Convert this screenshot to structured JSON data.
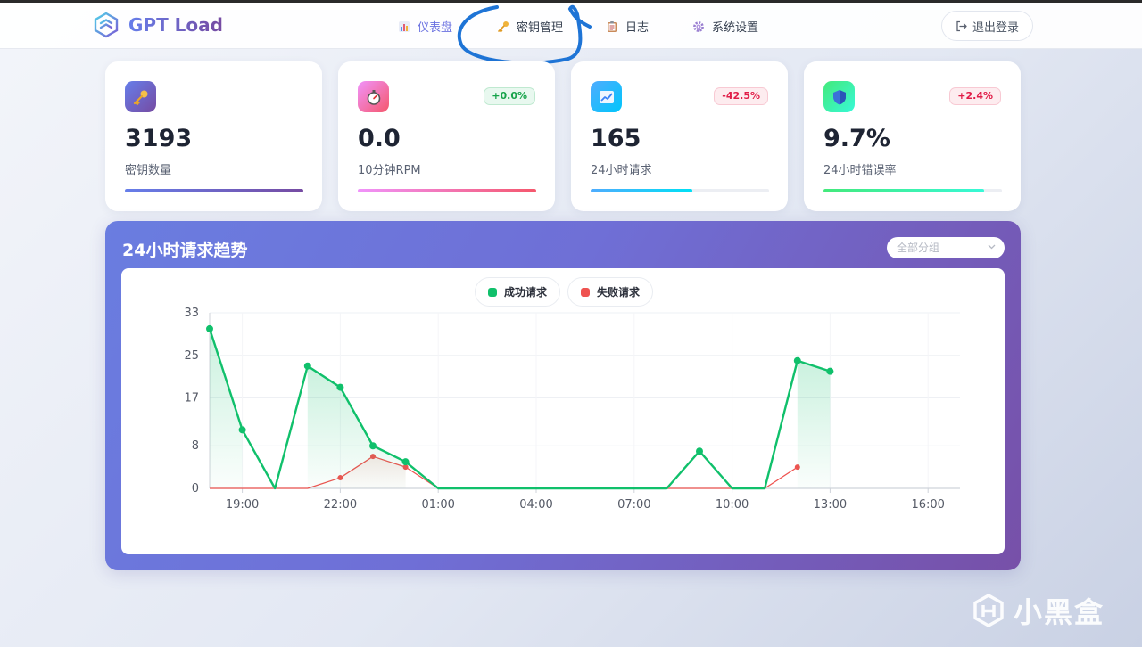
{
  "app": {
    "name": "GPT Load"
  },
  "nav": {
    "items": [
      {
        "label": "仪表盘",
        "icon": "bar-chart-icon",
        "active": true
      },
      {
        "label": "密钥管理",
        "icon": "key-icon",
        "active": false
      },
      {
        "label": "日志",
        "icon": "clipboard-icon",
        "active": false
      },
      {
        "label": "系统设置",
        "icon": "gear-icon",
        "active": false
      }
    ],
    "logout_label": "退出登录"
  },
  "stats": [
    {
      "value": "3193",
      "label": "密钥数量",
      "badge": "",
      "icon": "key-icon",
      "progress": 1.0,
      "color": "#764ba2"
    },
    {
      "value": "0.0",
      "label": "10分钟RPM",
      "badge": "+0.0%",
      "icon": "stopwatch-icon",
      "progress": 1.0,
      "color": "#f5576c"
    },
    {
      "value": "165",
      "label": "24小时请求",
      "badge": "-42.5%",
      "icon": "trend-chart-icon",
      "progress": 0.57,
      "color": "#00c6fb"
    },
    {
      "value": "9.7%",
      "label": "24小时错误率",
      "badge": "+2.4%",
      "icon": "shield-icon",
      "progress": 0.9,
      "color": "#38f9d7"
    }
  ],
  "trend": {
    "title": "24小时请求趋势",
    "group_filter": {
      "placeholder": "全部分组"
    }
  },
  "chart_data": {
    "type": "line",
    "x": [
      "18:00",
      "19:00",
      "20:00",
      "21:00",
      "22:00",
      "23:00",
      "00:00",
      "01:00",
      "02:00",
      "03:00",
      "04:00",
      "05:00",
      "06:00",
      "07:00",
      "08:00",
      "09:00",
      "10:00",
      "11:00",
      "12:00",
      "13:00",
      "14:00",
      "15:00",
      "16:00",
      "17:00"
    ],
    "xtick_labels": [
      "19:00",
      "22:00",
      "01:00",
      "04:00",
      "07:00",
      "10:00",
      "13:00",
      "16:00"
    ],
    "yticks": [
      0,
      8,
      17,
      25,
      33
    ],
    "ylim": [
      0,
      33
    ],
    "series": [
      {
        "name": "成功请求",
        "color": "#10c06b",
        "values": [
          30,
          11,
          0,
          23,
          19,
          8,
          5,
          0,
          0,
          0,
          0,
          0,
          0,
          0,
          0,
          7,
          0,
          0,
          24,
          22,
          null,
          null,
          null,
          null
        ]
      },
      {
        "name": "失败请求",
        "color": "#ef5350",
        "values": [
          0,
          0,
          0,
          0,
          2,
          6,
          4,
          0,
          0,
          0,
          0,
          0,
          0,
          0,
          0,
          0,
          0,
          0,
          4,
          null,
          null,
          null,
          null,
          null
        ]
      }
    ],
    "legend_position": "top-center",
    "grid": true
  },
  "watermark": {
    "text": "小黑盒"
  }
}
